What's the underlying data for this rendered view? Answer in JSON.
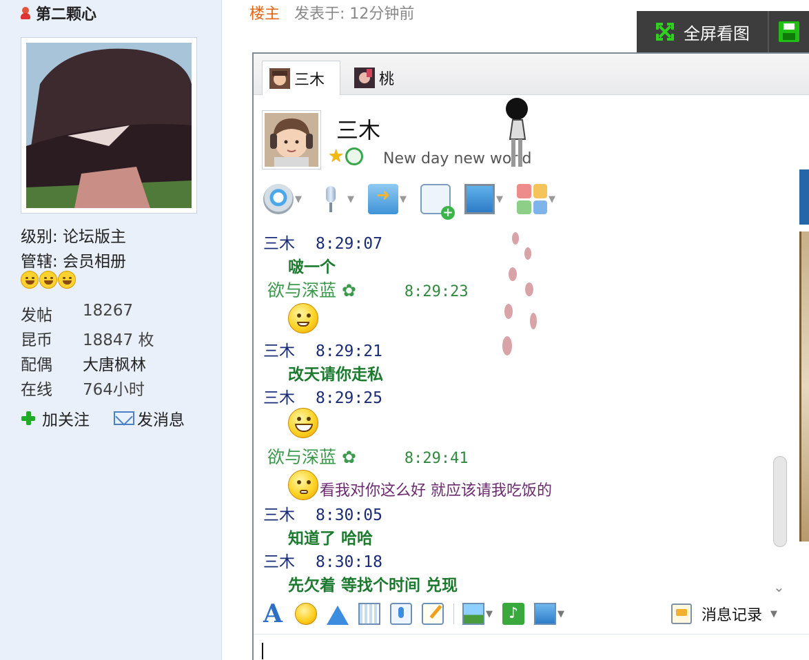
{
  "sidebar": {
    "username": "第二颗心",
    "level": "级别: 论坛版主",
    "manage": "管辖: 会员相册",
    "stats": [
      {
        "label": "发帖",
        "value": "18267"
      },
      {
        "label": "昆币",
        "value": "18847 枚"
      },
      {
        "label": "配偶",
        "value": "大唐枫林"
      },
      {
        "label": "在线",
        "value": "764小时"
      }
    ],
    "follow_label": "加关注",
    "message_label": "发消息"
  },
  "post_meta": {
    "floor": "楼主",
    "posted": "发表于: 12分钟前"
  },
  "viewer": {
    "fullscreen_label": "全屏看图"
  },
  "qq": {
    "tabs": [
      {
        "label": "三木"
      },
      {
        "label": "桃"
      }
    ],
    "contact_name": "三木",
    "signature": "New day new world",
    "messages": [
      {
        "sender": "三木",
        "time": "8:29:07",
        "text": "啵一个"
      },
      {
        "sender": "欲与深蓝",
        "time": "8:29:23"
      },
      {
        "sender": "三木",
        "time": "8:29:21",
        "text": "改天请你走私"
      },
      {
        "sender": "三木",
        "time": "8:29:25"
      },
      {
        "sender": "欲与深蓝",
        "time": "8:29:41",
        "text": "看我对你这么好 就应该请我吃饭的"
      },
      {
        "sender": "三木",
        "time": "8:30:05",
        "text": "知道了 哈哈"
      },
      {
        "sender": "三木",
        "time": "8:30:18",
        "text": "先欠着 等找个时间 兑现"
      }
    ],
    "history_label": "消息记录"
  }
}
